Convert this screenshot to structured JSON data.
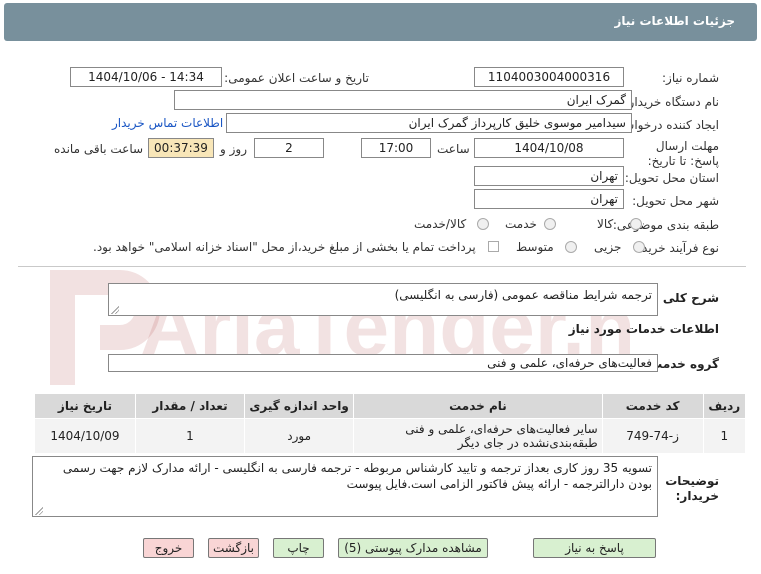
{
  "header": {
    "title": "جزئیات اطلاعات نیاز"
  },
  "form": {
    "need_number_label": "شماره نیاز:",
    "need_number": "1104003004000316",
    "announce_label": "تاریخ و ساعت اعلان عمومی:",
    "announce_value": "1404/10/06 - 14:34",
    "buyer_org_label": "نام دستگاه خریدار:",
    "buyer_org": "گمرک ایران",
    "creator_label": "ایجاد کننده درخواست:",
    "creator": "سیدامیر موسوی خلیق کارپرداز گمرک ایران",
    "contact_link": "اطلاعات تماس خریدار",
    "deadline_label": "مهلت ارسال پاسخ: تا تاریخ:",
    "deadline_date": "1404/10/08",
    "time_label": "ساعت",
    "deadline_time": "17:00",
    "days_value": "2",
    "days_label": "روز و",
    "remaining_time": "00:37:39",
    "remaining_label": "ساعت باقی مانده",
    "province_label": "استان محل تحویل:",
    "province": "تهران",
    "city_label": "شهر محل تحویل:",
    "city": "تهران",
    "category_label": "طبقه بندی موضوعی:",
    "category_options": [
      "کالا",
      "خدمت",
      "کالا/خدمت"
    ],
    "purchase_type_label": "نوع فرآیند خرید :",
    "purchase_options": [
      "جزیی",
      "متوسط"
    ],
    "payment_note": "پرداخت تمام یا بخشی از مبلغ خرید،از محل \"اسناد خزانه اسلامی\" خواهد بود."
  },
  "summary": {
    "label": "شرح کلی نیاز:",
    "value": "ترجمه شرایط مناقصه عمومی (فارسی به انگلیسی)"
  },
  "services_section": {
    "title": "اطلاعات خدمات مورد نیاز",
    "group_label": "گروه خدمت:",
    "group_value": "فعالیت‌های حرفه‌ای، علمی و فنی"
  },
  "table": {
    "headers": [
      "ردیف",
      "کد خدمت",
      "نام خدمت",
      "واحد اندازه گیری",
      "تعداد / مقدار",
      "تاریخ نیاز"
    ],
    "rows": [
      [
        "1",
        "ز-74-749",
        "سایر فعالیت‌های حرفه‌ای، علمی و فنی طبقه‌بندی‌نشده در جای دیگر",
        "مورد",
        "1",
        "1404/10/09"
      ]
    ]
  },
  "notes": {
    "label": "توضیحات خریدار:",
    "value": "تسویه 35 روز کاری بعداز ترجمه و تایید کارشناس مربوطه - ترجمه فارسی به انگلیسی - ارائه مدارک لازم جهت رسمی بودن دارالترجمه - ارائه پیش فاکتور الزامی است.فایل پیوست"
  },
  "buttons": {
    "reply": "پاسخ به نیاز",
    "docs": "مشاهده مدارک پیوستی (5)",
    "print": "چاپ",
    "back": "بازگشت",
    "exit": "خروج"
  },
  "watermark": {
    "text": "AriaTender.net"
  },
  "colors": {
    "header_bg": "#78909c",
    "remaining_bg": "#f8e6b8",
    "green_btn": "#d8f0d0",
    "red_btn": "#f9d5d5",
    "link": "#1a56c4"
  }
}
